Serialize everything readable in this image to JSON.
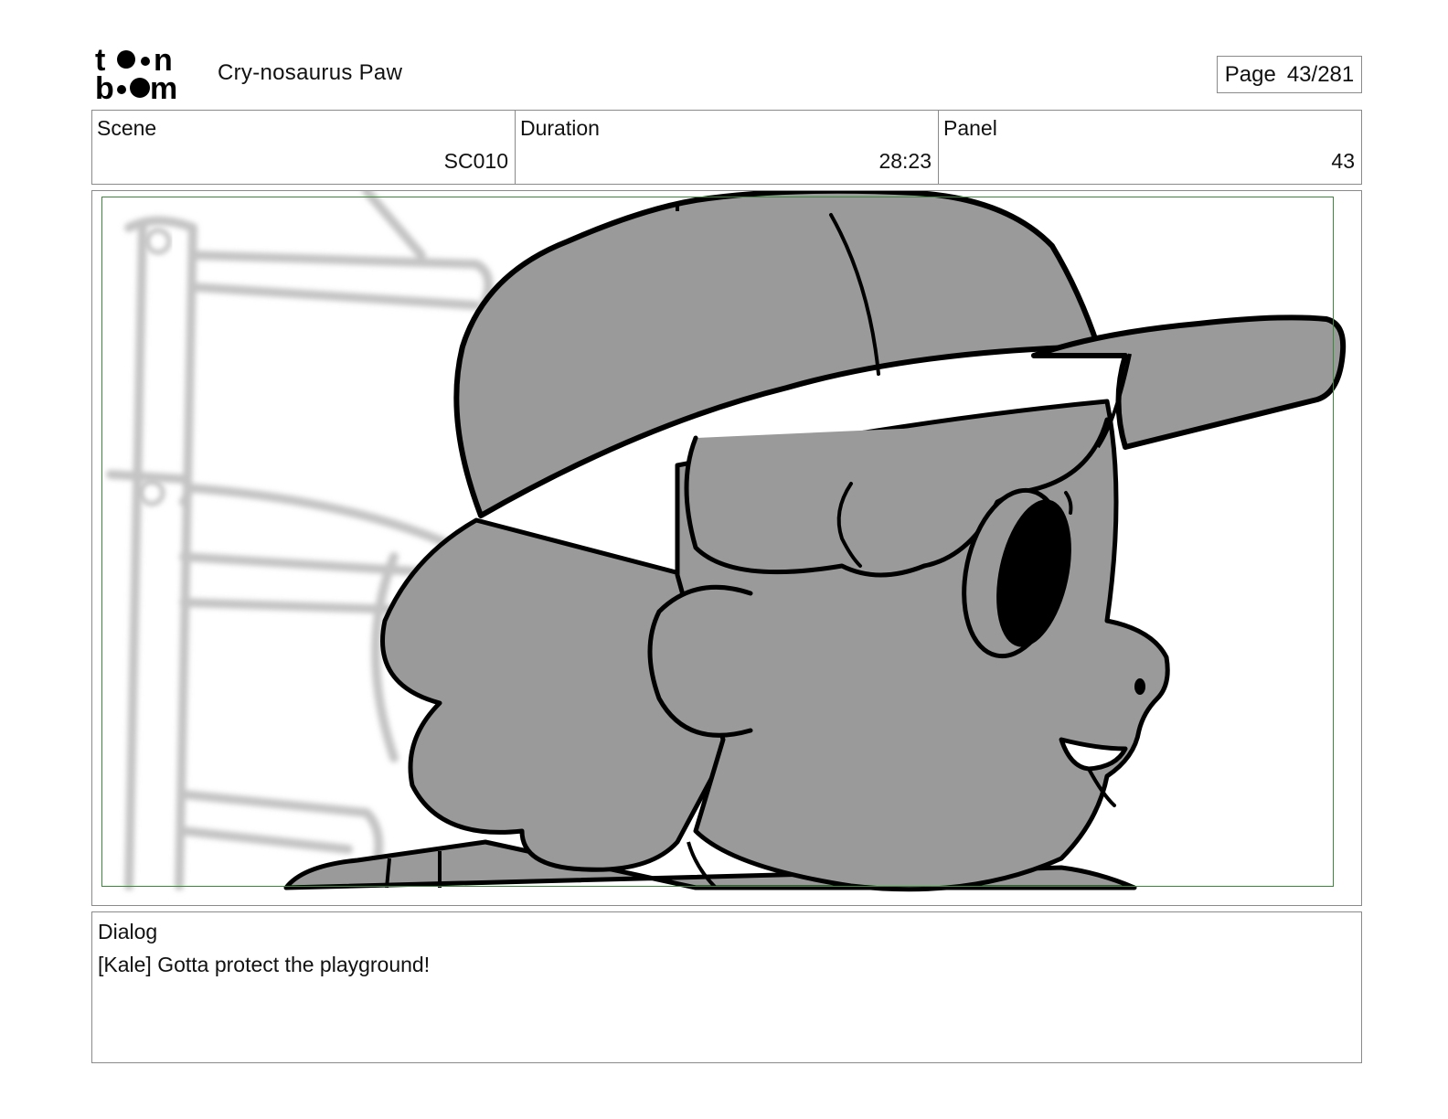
{
  "header": {
    "logo": {
      "icon": "toon-boom-logo",
      "text_line1": "t  n",
      "text_line2": "b  m"
    },
    "project_title": "Cry-nosaurus Paw",
    "page": {
      "label": "Page",
      "value": "43/281"
    }
  },
  "info": {
    "scene": {
      "label": "Scene",
      "value": "SC010"
    },
    "duration": {
      "label": "Duration",
      "value": "28:23"
    },
    "panel": {
      "label": "Panel",
      "value": "43"
    }
  },
  "artwork": {
    "icon": "storyboard-drawing",
    "colors": {
      "character_fill": "#9a9a9a",
      "outline": "#000000",
      "background_sketch": "#c8c8c8",
      "safe_area": "#3a8a3a"
    }
  },
  "dialog": {
    "label": "Dialog",
    "text": "[Kale] Gotta protect the playground!"
  }
}
